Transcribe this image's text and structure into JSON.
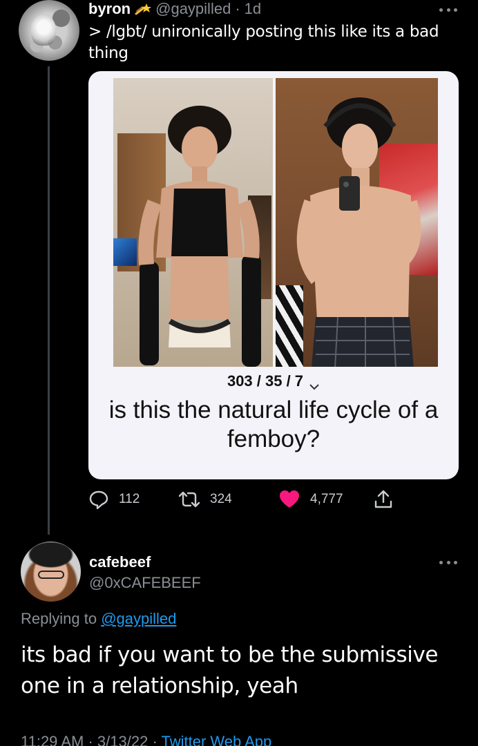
{
  "tweet": {
    "display_name": "byron",
    "handle": "@gaypilled",
    "separator": "·",
    "time": "1d",
    "text": "> /lgbt/ unironically posting this like its a bad thing",
    "media": {
      "post_counts": "303 / 35 / 7",
      "caption": "is this the natural life cycle of a femboy?"
    },
    "actions": {
      "replies": "112",
      "retweets": "324",
      "likes": "4,777"
    },
    "colors": {
      "like": "#f91880",
      "link": "#1d9bf0",
      "muted": "#8a8f95"
    }
  },
  "reply": {
    "display_name": "cafebeef",
    "handle": "@0xCAFEBEEF",
    "replying_prefix": "Replying to",
    "replying_to": "@gaypilled",
    "text": "its bad if you want to be the submissive one in a relationship, yeah",
    "time": "11:29 AM",
    "date": "3/13/22",
    "separator": "·",
    "app": "Twitter Web App"
  }
}
